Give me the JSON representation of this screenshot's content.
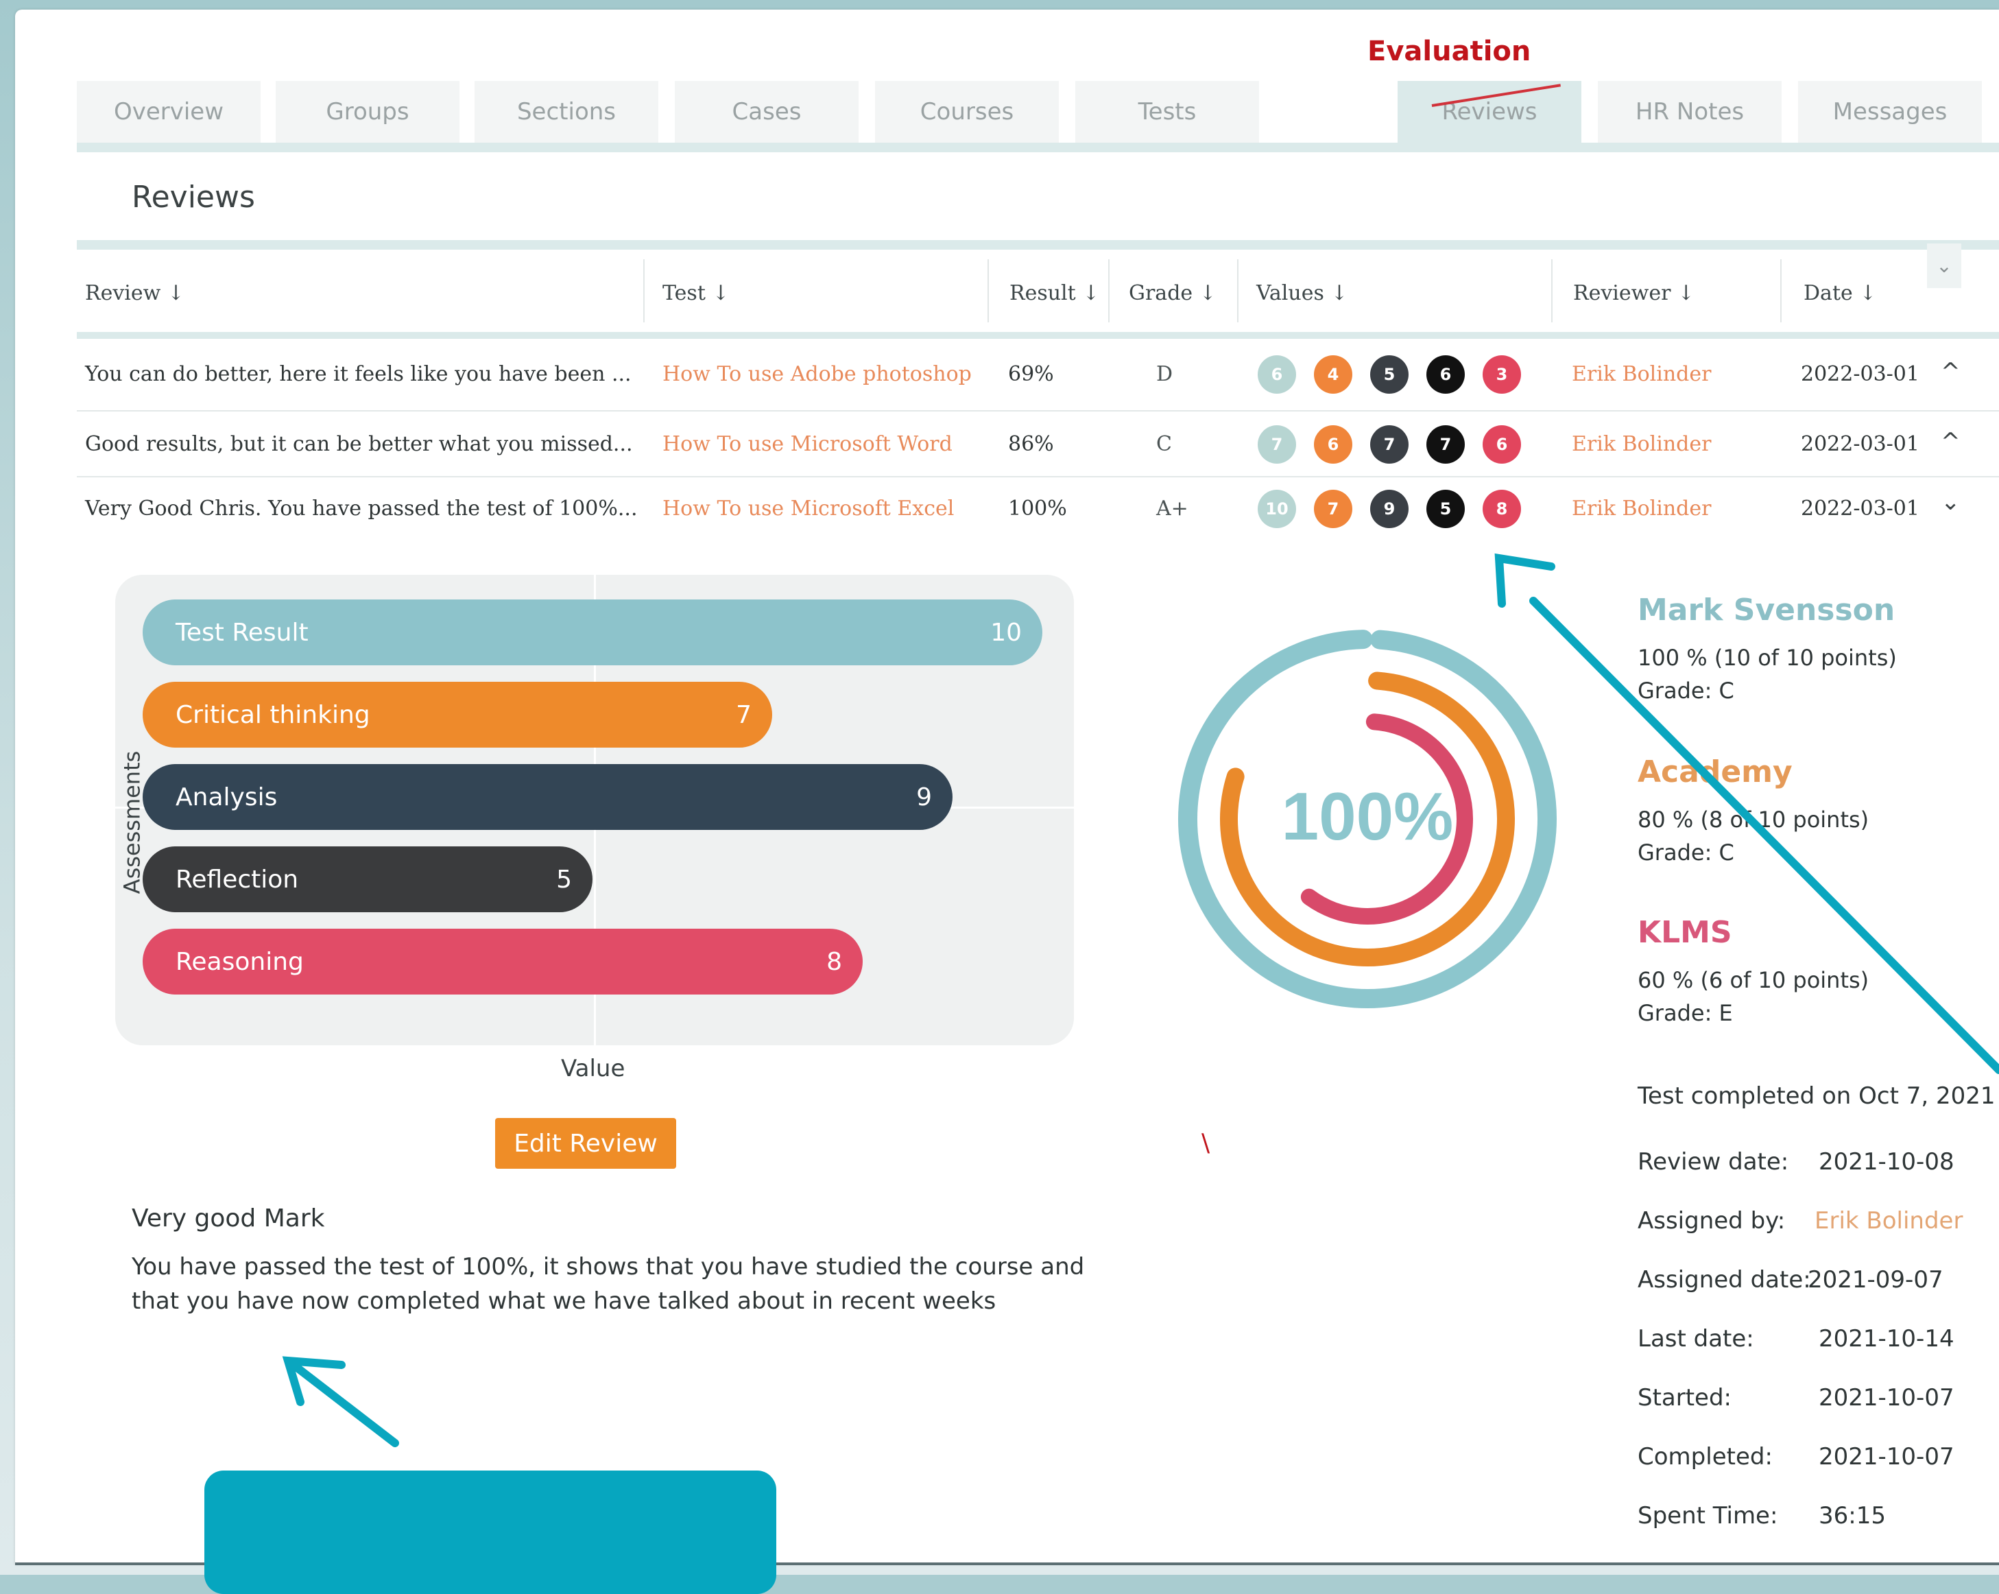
{
  "header": {
    "section_label": "Evaluation",
    "tabs": [
      {
        "label": "Overview",
        "active": false
      },
      {
        "label": "Groups",
        "active": false
      },
      {
        "label": "Sections",
        "active": false
      },
      {
        "label": "Cases",
        "active": false
      },
      {
        "label": "Courses",
        "active": false
      },
      {
        "label": "Tests",
        "active": false
      },
      {
        "label": "Reviews",
        "active": true
      },
      {
        "label": "HR Notes",
        "active": false
      },
      {
        "label": "Messages",
        "active": false
      }
    ]
  },
  "page_title": "Reviews",
  "table": {
    "columns": [
      "Review ↓",
      "Test ↓",
      "Result ↓",
      "Grade ↓",
      "Values ↓",
      "Reviewer ↓",
      "Date ↓"
    ],
    "expand_icon": "chevron-down-icon",
    "rows": [
      {
        "review": "You can do better, here it feels like you have been ...",
        "test": "How To use Adobe photoshop",
        "result": "69%",
        "grade": "D",
        "values": [
          "6",
          "4",
          "5",
          "6",
          "3"
        ],
        "reviewer": "Erik Bolinder",
        "date": "2022-03-01",
        "toggle": "^"
      },
      {
        "review": "Good results, but it can be better what you missed...",
        "test": "How To use Microsoft Word",
        "result": "86%",
        "grade": "C",
        "values": [
          "7",
          "6",
          "7",
          "7",
          "6"
        ],
        "reviewer": "Erik Bolinder",
        "date": "2022-03-01",
        "toggle": "^"
      },
      {
        "review": "Very Good Chris. You have passed the test of 100%...",
        "test": "How To use Microsoft Excel",
        "result": "100%",
        "grade": "A+",
        "values": [
          "10",
          "7",
          "9",
          "5",
          "8"
        ],
        "reviewer": "Erik Bolinder",
        "date": "2022-03-01",
        "toggle": "⌄"
      }
    ]
  },
  "value_colors": [
    "#b7d5d2",
    "#f0853a",
    "#3a3f45",
    "#111111",
    "#e2455d"
  ],
  "chart_data": {
    "type": "bar",
    "orientation": "horizontal",
    "categories": [
      "Test Result",
      "Critical thinking",
      "Analysis",
      "Reflection",
      "Reasoning"
    ],
    "values": [
      10,
      7,
      9,
      5,
      8
    ],
    "colors": [
      "#8dc3cb",
      "#ee8a2b",
      "#334555",
      "#3a3b3d",
      "#e14c67"
    ],
    "xlabel": "Value",
    "ylabel": "Assessments",
    "xlim": [
      0,
      10
    ]
  },
  "donut": {
    "label": "100%",
    "rings": [
      {
        "name": "Mark Svensson",
        "fraction": 1.0,
        "color": "#8cc6cd"
      },
      {
        "name": "Academy",
        "fraction": 0.8,
        "color": "#ea8a2b"
      },
      {
        "name": "KLMS",
        "fraction": 0.6,
        "color": "#d84a6a"
      }
    ]
  },
  "edit_button": "Edit Review",
  "comment": {
    "title": "Very good Mark",
    "body": "You have passed the test of 100%, it shows that you have studied the course and that you have now completed what we have talked about in recent weeks"
  },
  "summary": [
    {
      "name": "Mark Svensson",
      "color": "#8cbfc6",
      "line1": "100 %  (10 of 10 points)",
      "line2": "Grade: C"
    },
    {
      "name": "Academy",
      "color": "#e59a58",
      "line1": "80 %  (8 of 10 points)",
      "line2": "Grade: C"
    },
    {
      "name": "KLMS",
      "color": "#d8577a",
      "line1": "60 %  (6 of 10 points)",
      "line2": "Grade: E"
    }
  ],
  "completed_line": "Test completed on Oct 7, 2021",
  "details": [
    {
      "label": "Review date:",
      "value": "2021-10-08"
    },
    {
      "label": "Assigned by:",
      "value": "Erik Bolinder"
    },
    {
      "label": "Assigned date:",
      "value": "2021-09-07"
    },
    {
      "label": "Last date:",
      "value": "2021-10-14"
    },
    {
      "label": "Started:",
      "value": "2021-10-07"
    },
    {
      "label": "Completed:",
      "value": "2021-10-07"
    },
    {
      "label": "Spent Time:",
      "value": "36:15"
    }
  ],
  "annotation_color": "#0aa6bf"
}
